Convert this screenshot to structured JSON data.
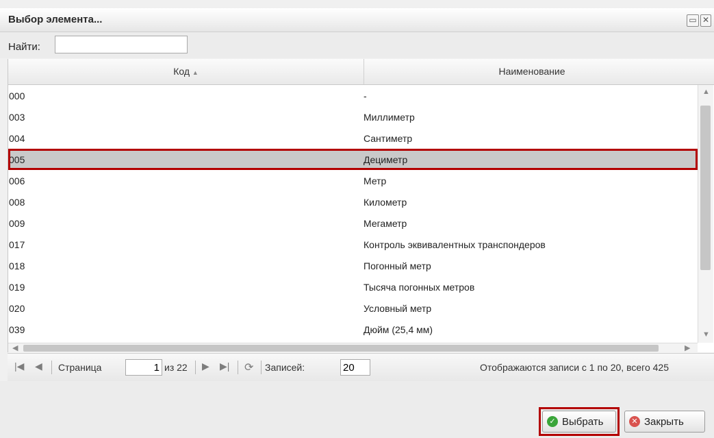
{
  "window": {
    "title": "Выбор элемента..."
  },
  "search": {
    "label": "Найти:",
    "value": ""
  },
  "grid": {
    "columns": [
      {
        "label": "Код"
      },
      {
        "label": "Наименование"
      }
    ],
    "sort_indicator": "▲",
    "selected_index": 3,
    "rows": [
      {
        "code": "000",
        "name": "-"
      },
      {
        "code": "003",
        "name": "Миллиметр"
      },
      {
        "code": "004",
        "name": "Сантиметр"
      },
      {
        "code": "005",
        "name": "Дециметр"
      },
      {
        "code": "006",
        "name": "Метр"
      },
      {
        "code": "008",
        "name": "Километр"
      },
      {
        "code": "009",
        "name": "Мегаметр"
      },
      {
        "code": "017",
        "name": "Контроль эквивалентных транспондеров"
      },
      {
        "code": "018",
        "name": "Погонный метр"
      },
      {
        "code": "019",
        "name": "Тысяча погонных метров"
      },
      {
        "code": "020",
        "name": "Условный метр"
      },
      {
        "code": "039",
        "name": "Дюйм (25,4 мм)"
      }
    ]
  },
  "pager": {
    "page_label": "Страница",
    "page_value": "1",
    "of_label": "из 22",
    "records_label": "Записей:",
    "records_value": "20",
    "summary": "Отображаются записи с 1 по 20, всего 425"
  },
  "buttons": {
    "select": "Выбрать",
    "close": "Закрыть"
  },
  "icons": {
    "maximize": "maximize-icon",
    "close": "close-icon",
    "first": "first-page-icon",
    "prev": "prev-page-icon",
    "next": "next-page-icon",
    "last": "last-page-icon",
    "refresh": "refresh-icon"
  },
  "colors": {
    "highlight": "#b30000",
    "selected_row": "#c9c9c9",
    "select_icon": "#3aa53a",
    "close_icon": "#d9534f"
  }
}
